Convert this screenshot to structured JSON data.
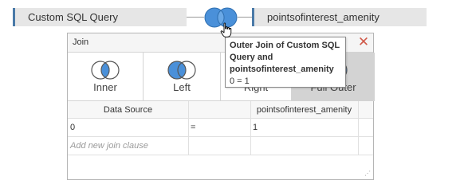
{
  "left_table": {
    "name": "Custom SQL Query"
  },
  "right_table": {
    "name": "pointsofinterest_amenity"
  },
  "join_icon": {
    "name": "outer-join-icon",
    "color": "#4a90d9"
  },
  "dialog": {
    "title": "Join",
    "close_icon": "close-icon",
    "join_types": [
      {
        "label": "Inner",
        "state": "normal"
      },
      {
        "label": "Left",
        "state": "normal"
      },
      {
        "label": "Right",
        "state": "normal"
      },
      {
        "label": "Full Outer",
        "state": "selected"
      }
    ],
    "grid": {
      "headers": [
        "Data Source",
        "",
        "pointsofinterest_amenity"
      ],
      "rows": [
        {
          "left": "0",
          "operator": "=",
          "right": "1"
        }
      ],
      "add_placeholder": "Add new join clause"
    }
  },
  "tooltip": {
    "title": "Outer Join of Custom SQL Query and pointsofinterest_amenity",
    "clause": "0 = 1"
  },
  "colors": {
    "accent": "#4a90d9",
    "table_border": "#4a7aa8",
    "close": "#d05a4a",
    "selected_bg": "#d3d3d3"
  }
}
